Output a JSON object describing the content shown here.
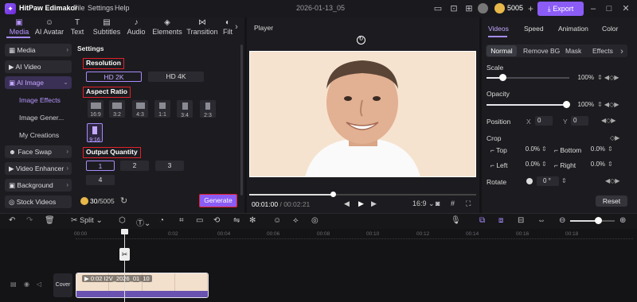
{
  "app": {
    "name": "HitPaw Edimakor",
    "menu": [
      "File",
      "Settings",
      "Help"
    ],
    "project": "2026-01-13_05",
    "credits": "5005",
    "export_label": "Export"
  },
  "left_tabs": [
    {
      "label": "Media",
      "icon": "media-icon"
    },
    {
      "label": "AI Avatar",
      "icon": "avatar-icon"
    },
    {
      "label": "Text",
      "icon": "text-icon"
    },
    {
      "label": "Subtitles",
      "icon": "subtitles-icon"
    },
    {
      "label": "Audio",
      "icon": "audio-icon"
    },
    {
      "label": "Elements",
      "icon": "elements-icon"
    },
    {
      "label": "Transition",
      "icon": "transition-icon"
    },
    {
      "label": "Filt",
      "icon": "filter-icon"
    }
  ],
  "sidebar": {
    "items": [
      "Media",
      "AI Video",
      "AI Image",
      "Face Swap",
      "Video Enhancer",
      "Background",
      "Stock Videos"
    ],
    "subitems": [
      "Image Effects",
      "Image Gener...",
      "My Creations"
    ]
  },
  "settings": {
    "title": "Settings",
    "resolution_label": "Resolution",
    "resolution_options": [
      "HD 2K",
      "HD 4K"
    ],
    "aspect_label": "Aspect Ratio",
    "aspect_options": [
      "16:9",
      "3:2",
      "4:3",
      "1:1",
      "3:4",
      "2:3",
      "9:16"
    ],
    "quantity_label": "Output Quantity",
    "quantity_options": [
      "1",
      "2",
      "3",
      "4"
    ],
    "credits_used": "30",
    "credits_total": "/5005",
    "generate_label": "Generate"
  },
  "player": {
    "title": "Player",
    "current_time": "00:01:00",
    "total_time": "/ 00:02:21",
    "ratio": "16:9",
    "progress": 0.37
  },
  "right_panel": {
    "tabs": [
      "Videos",
      "Speed",
      "Animation",
      "Color"
    ],
    "subtabs": [
      "Normal",
      "Remove BG",
      "Mask",
      "Effects"
    ],
    "scale_label": "Scale",
    "scale_value": "100%",
    "opacity_label": "Opacity",
    "opacity_value": "100%",
    "position_label": "Position",
    "pos_x_label": "X",
    "pos_x": "0",
    "pos_y_label": "Y",
    "pos_y": "0",
    "crop_label": "Crop",
    "crop_top_label": "Top",
    "crop_top": "0.0%",
    "crop_bottom_label": "Bottom",
    "crop_bottom": "0.0%",
    "crop_left_label": "Left",
    "crop_left": "0.0%",
    "crop_right_label": "Right",
    "crop_right": "0.0%",
    "rotate_label": "Rotate",
    "rotate_value": "0 °",
    "reset_label": "Reset"
  },
  "toolbar": {
    "split_label": "Split"
  },
  "timeline": {
    "ruler": [
      "00:00",
      "0:02",
      "00:04",
      "00:06",
      "00:08",
      "00:10",
      "00:12",
      "00:14",
      "00:16",
      "00:18"
    ],
    "cover_label": "Cover",
    "clip_label": "0:02 I2V_2026_01_10"
  },
  "colors": {
    "accent": "#8b5cf6",
    "highlight_box": "#e0202a"
  }
}
